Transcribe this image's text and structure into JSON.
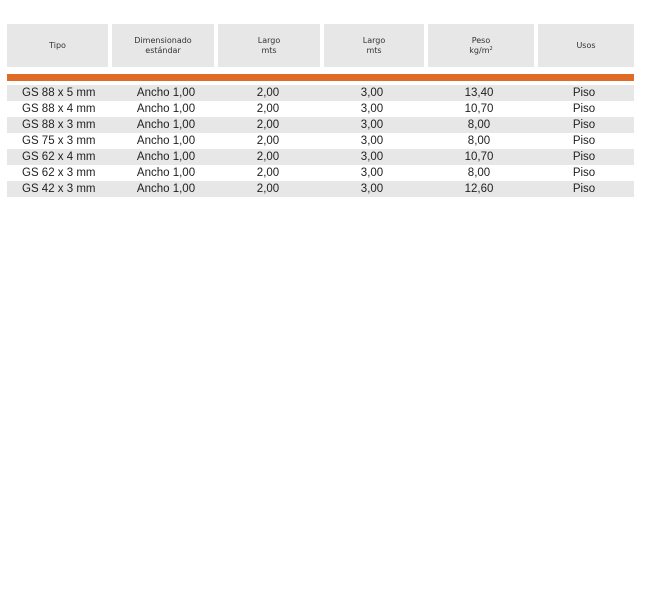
{
  "table": {
    "headers": [
      {
        "lines": [
          "Tipo"
        ]
      },
      {
        "lines": [
          "Dimensionado",
          "estándar"
        ]
      },
      {
        "lines": [
          "Largo",
          "mts"
        ]
      },
      {
        "lines": [
          "Largo",
          "mts"
        ]
      },
      {
        "lines": [
          "Peso",
          "kg/m"
        ],
        "superscript": "2"
      },
      {
        "lines": [
          "Usos"
        ]
      }
    ],
    "rows": [
      {
        "tipo": "GS 88 x 5 mm",
        "dim": "Ancho 1,00",
        "largo1": "2,00",
        "largo2": "3,00",
        "peso": "13,40",
        "usos": "Piso"
      },
      {
        "tipo": "GS 88 x 4 mm",
        "dim": "Ancho 1,00",
        "largo1": "2,00",
        "largo2": "3,00",
        "peso": "10,70",
        "usos": "Piso"
      },
      {
        "tipo": "GS 88 x 3 mm",
        "dim": "Ancho 1,00",
        "largo1": "2,00",
        "largo2": "3,00",
        "peso": "8,00",
        "usos": "Piso"
      },
      {
        "tipo": "GS 75 x 3 mm",
        "dim": "Ancho 1,00",
        "largo1": "2,00",
        "largo2": "3,00",
        "peso": "8,00",
        "usos": "Piso"
      },
      {
        "tipo": "GS 62 x 4 mm",
        "dim": "Ancho 1,00",
        "largo1": "2,00",
        "largo2": "3,00",
        "peso": "10,70",
        "usos": "Piso"
      },
      {
        "tipo": "GS 62 x 3 mm",
        "dim": "Ancho 1,00",
        "largo1": "2,00",
        "largo2": "3,00",
        "peso": "8,00",
        "usos": "Piso"
      },
      {
        "tipo": "GS 42 x 3 mm",
        "dim": "Ancho 1,00",
        "largo1": "2,00",
        "largo2": "3,00",
        "peso": "12,60",
        "usos": "Piso"
      }
    ]
  },
  "colors": {
    "accent": "#e06b27",
    "header_bg": "#e7e7e8",
    "row_shade": "#e7e7e8"
  }
}
